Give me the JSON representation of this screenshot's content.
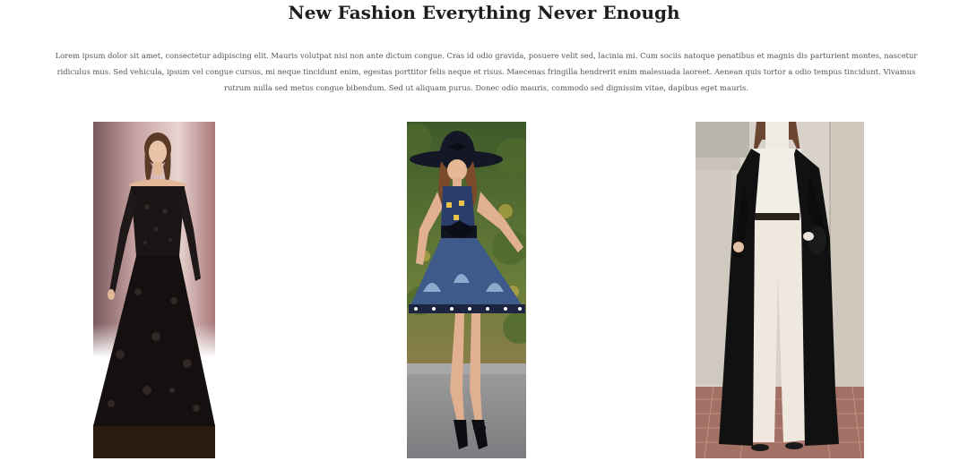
{
  "header": {
    "title": "New Fashion Everything Never Enough"
  },
  "intro": {
    "text": "Lorem ipsum dolor sit amet, consectetur adipiscing elit. Mauris volutpat nisi non ante dictum congue. Cras id odio gravida, posuere velit sed, lacinia mi. Cum sociis natoque penatibus et magnis dis parturient montes, nascetur ridiculus mus. Sed vehicula, ipsum vel congue cursus, mi neque tincidunt enim, egestas porttitor felis neque et risus. Maecenas fringilla hendrerit enim malesuada laoreet. Aenean quis tortor a odio tempus tincidunt. Vivamus rutrum nulla sed metus congue bibendum. Sed ut aliquam purus. Donec odio mauris, commodo sed dignissim vitae, dapibus eget mauris."
  },
  "gallery": {
    "items": [
      {
        "subject": "black lace off-shoulder evening gown"
      },
      {
        "subject": "wide-brim black hat with patterned blue skater dress"
      },
      {
        "subject": "long black coat over white turtleneck and wide trousers"
      }
    ]
  },
  "colors": {
    "title": "#1e1e1e",
    "body_text": "#555555",
    "background": "#ffffff"
  }
}
